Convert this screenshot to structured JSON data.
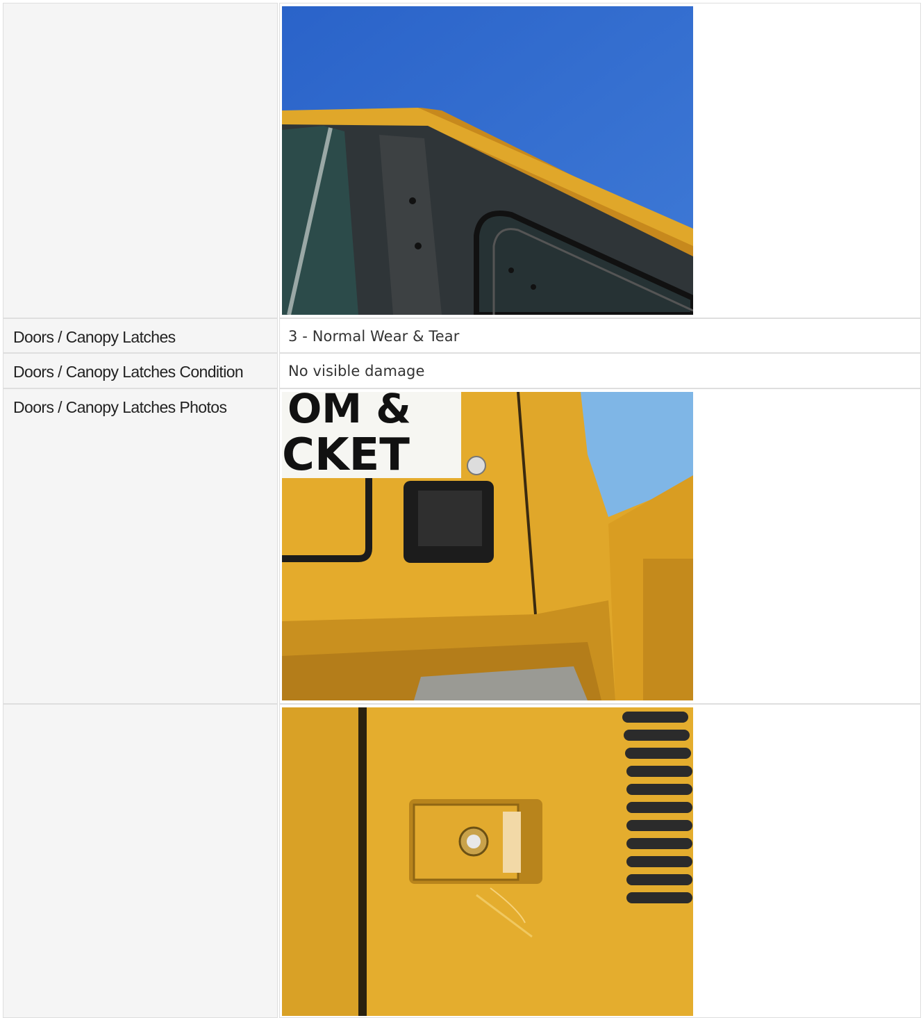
{
  "rows": [
    {
      "label": "",
      "value": "",
      "photo": "cab-canopy-photo"
    },
    {
      "label": "Doors / Canopy Latches",
      "value": "3 - Normal Wear & Tear"
    },
    {
      "label": "Doors / Canopy Latches Condition",
      "value": "No visible damage"
    },
    {
      "label": "Doors / Canopy Latches Photos",
      "value": "",
      "photo": "door-handle-photo"
    },
    {
      "label": "",
      "value": "",
      "photo": "latch-closeup-photo"
    }
  ],
  "photo_text": {
    "sign_line1": "OM &",
    "sign_line2": "CKET"
  },
  "colors": {
    "label_bg": "#f5f5f5",
    "border": "#dedede",
    "machine_yellow": "#e2a722",
    "sky_blue": "#2f6fcf"
  }
}
